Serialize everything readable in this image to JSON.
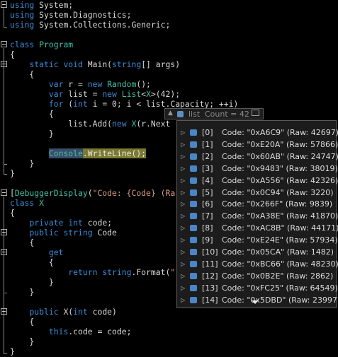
{
  "code_lines": [
    {
      "id": "l1",
      "parts": [
        {
          "t": "using",
          "c": "kw"
        },
        {
          "t": " System;"
        }
      ]
    },
    {
      "id": "l2",
      "parts": [
        {
          "t": "using",
          "c": "kw"
        },
        {
          "t": " System.Diagnostics;"
        }
      ]
    },
    {
      "id": "l3",
      "parts": [
        {
          "t": "using",
          "c": "kw"
        },
        {
          "t": " System.Collections.Generic;"
        }
      ]
    },
    {
      "id": "l4",
      "parts": [
        {
          "t": "class",
          "c": "kw"
        },
        {
          "t": " "
        },
        {
          "t": "Program",
          "c": "ty"
        }
      ]
    },
    {
      "id": "l5",
      "parts": [
        {
          "t": "{"
        }
      ]
    },
    {
      "id": "l6",
      "parts": [
        {
          "t": "    "
        },
        {
          "t": "static",
          "c": "kw"
        },
        {
          "t": " "
        },
        {
          "t": "void",
          "c": "kw"
        },
        {
          "t": " Main("
        },
        {
          "t": "string",
          "c": "kw"
        },
        {
          "t": "[] args)"
        }
      ]
    },
    {
      "id": "l7",
      "parts": [
        {
          "t": "    {"
        }
      ]
    },
    {
      "id": "l8",
      "parts": [
        {
          "t": "        "
        },
        {
          "t": "var",
          "c": "kw"
        },
        {
          "t": " r = "
        },
        {
          "t": "new",
          "c": "kw"
        },
        {
          "t": " "
        },
        {
          "t": "Random",
          "c": "ty"
        },
        {
          "t": "();"
        }
      ]
    },
    {
      "id": "l9",
      "parts": [
        {
          "t": "        "
        },
        {
          "t": "var",
          "c": "kw"
        },
        {
          "t": " list = "
        },
        {
          "t": "new",
          "c": "kw"
        },
        {
          "t": " "
        },
        {
          "t": "List",
          "c": "ty"
        },
        {
          "t": "<"
        },
        {
          "t": "X",
          "c": "ty"
        },
        {
          "t": ">(42);"
        }
      ]
    },
    {
      "id": "l10",
      "parts": [
        {
          "t": "        "
        },
        {
          "t": "for",
          "c": "kw"
        },
        {
          "t": " ("
        },
        {
          "t": "int",
          "c": "kw"
        },
        {
          "t": " i = 0; i < list.Capacity; ++i)"
        }
      ]
    },
    {
      "id": "l11",
      "parts": [
        {
          "t": "        {"
        }
      ]
    },
    {
      "id": "l12",
      "parts": [
        {
          "t": "            list.Add("
        },
        {
          "t": "new",
          "c": "kw"
        },
        {
          "t": " "
        },
        {
          "t": "X",
          "c": "ty"
        },
        {
          "t": "(r.Next"
        }
      ]
    },
    {
      "id": "l13",
      "parts": [
        {
          "t": "        }"
        }
      ]
    },
    {
      "id": "l14",
      "parts": [
        {
          "t": ""
        }
      ]
    },
    {
      "id": "l15",
      "parts": [
        {
          "t": "        "
        },
        {
          "t": "Console",
          "c": "ty hl-console"
        },
        {
          "t": ".WriteLine();",
          "c": "hl-line"
        }
      ]
    },
    {
      "id": "l16",
      "parts": [
        {
          "t": "    }"
        }
      ]
    },
    {
      "id": "l17",
      "parts": [
        {
          "t": "}"
        }
      ]
    },
    {
      "id": "l18",
      "parts": [
        {
          "t": ""
        }
      ]
    },
    {
      "id": "l19",
      "parts": [
        {
          "t": "["
        },
        {
          "t": "DebuggerDisplay",
          "c": "ty"
        },
        {
          "t": "("
        },
        {
          "t": "\"Code: {Code} (Ra",
          "c": "st"
        }
      ]
    },
    {
      "id": "l20",
      "parts": [
        {
          "t": "class",
          "c": "kw"
        },
        {
          "t": " "
        },
        {
          "t": "X",
          "c": "ty"
        }
      ]
    },
    {
      "id": "l21",
      "parts": [
        {
          "t": "{"
        }
      ]
    },
    {
      "id": "l22",
      "parts": [
        {
          "t": "    "
        },
        {
          "t": "private",
          "c": "kw"
        },
        {
          "t": " "
        },
        {
          "t": "int",
          "c": "kw"
        },
        {
          "t": " code;"
        }
      ]
    },
    {
      "id": "l23",
      "parts": [
        {
          "t": "    "
        },
        {
          "t": "public",
          "c": "kw"
        },
        {
          "t": " "
        },
        {
          "t": "string",
          "c": "kw"
        },
        {
          "t": " Code"
        }
      ]
    },
    {
      "id": "l24",
      "parts": [
        {
          "t": "    {"
        }
      ]
    },
    {
      "id": "l25",
      "parts": [
        {
          "t": "        "
        },
        {
          "t": "get",
          "c": "kw"
        }
      ]
    },
    {
      "id": "l26",
      "parts": [
        {
          "t": "        {"
        }
      ]
    },
    {
      "id": "l27",
      "parts": [
        {
          "t": "            "
        },
        {
          "t": "return",
          "c": "kw"
        },
        {
          "t": " "
        },
        {
          "t": "string",
          "c": "kw"
        },
        {
          "t": ".Format("
        },
        {
          "t": "\"",
          "c": "st"
        }
      ]
    },
    {
      "id": "l28",
      "parts": [
        {
          "t": "        }"
        }
      ]
    },
    {
      "id": "l29",
      "parts": [
        {
          "t": "    }"
        }
      ]
    },
    {
      "id": "l30",
      "parts": [
        {
          "t": ""
        }
      ]
    },
    {
      "id": "l31",
      "parts": [
        {
          "t": "    "
        },
        {
          "t": "public",
          "c": "kw"
        },
        {
          "t": " X("
        },
        {
          "t": "int",
          "c": "kw"
        },
        {
          "t": " code)"
        }
      ]
    },
    {
      "id": "l32",
      "parts": [
        {
          "t": "    {"
        }
      ]
    },
    {
      "id": "l33",
      "parts": [
        {
          "t": "        "
        },
        {
          "t": "this",
          "c": "kw"
        },
        {
          "t": ".code = code;"
        }
      ]
    },
    {
      "id": "l34",
      "parts": [
        {
          "t": "    }"
        }
      ]
    },
    {
      "id": "l35",
      "parts": [
        {
          "t": "}"
        }
      ]
    }
  ],
  "datatip": {
    "variable_name": "list",
    "value": "Count = 42",
    "expander_icon": "chevron-right-icon",
    "object_icon": "object-icon",
    "pin_icon": "pin-icon",
    "items": [
      {
        "index": "[0]",
        "text": "Code: \"0xA6C9\" (Raw: 42697)"
      },
      {
        "index": "[1]",
        "text": "Code: \"0xE20A\" (Raw: 57866)"
      },
      {
        "index": "[2]",
        "text": "Code: \"0x60AB\" (Raw: 24747)"
      },
      {
        "index": "[3]",
        "text": "Code: \"0x9483\" (Raw: 38019)"
      },
      {
        "index": "[4]",
        "text": "Code: \"0xA556\" (Raw: 42326)"
      },
      {
        "index": "[5]",
        "text": "Code: \"0x0C94\" (Raw: 3220)"
      },
      {
        "index": "[6]",
        "text": "Code: \"0x266F\" (Raw: 9839)"
      },
      {
        "index": "[7]",
        "text": "Code: \"0xA38E\" (Raw: 41870)"
      },
      {
        "index": "[8]",
        "text": "Code: \"0xAC8B\" (Raw: 44171)"
      },
      {
        "index": "[9]",
        "text": "Code: \"0xE24E\" (Raw: 57934)"
      },
      {
        "index": "[10]",
        "text": "Code: \"0x05CA\" (Raw: 1482)"
      },
      {
        "index": "[11]",
        "text": "Code: \"0xBC66\" (Raw: 48230)"
      },
      {
        "index": "[12]",
        "text": "Code: \"0x0B2E\" (Raw: 2862)"
      },
      {
        "index": "[13]",
        "text": "Code: \"0xFC25\" (Raw: 64549)"
      },
      {
        "index": "[14]",
        "text": "Code: \"0x5DBD\" (Raw: 23997)"
      }
    ]
  },
  "colors": {
    "background": "#000000",
    "keyword": "#3a8ad6",
    "type": "#42c0a6",
    "string": "#d69d85",
    "highlight_statement": "#7a7a30"
  }
}
